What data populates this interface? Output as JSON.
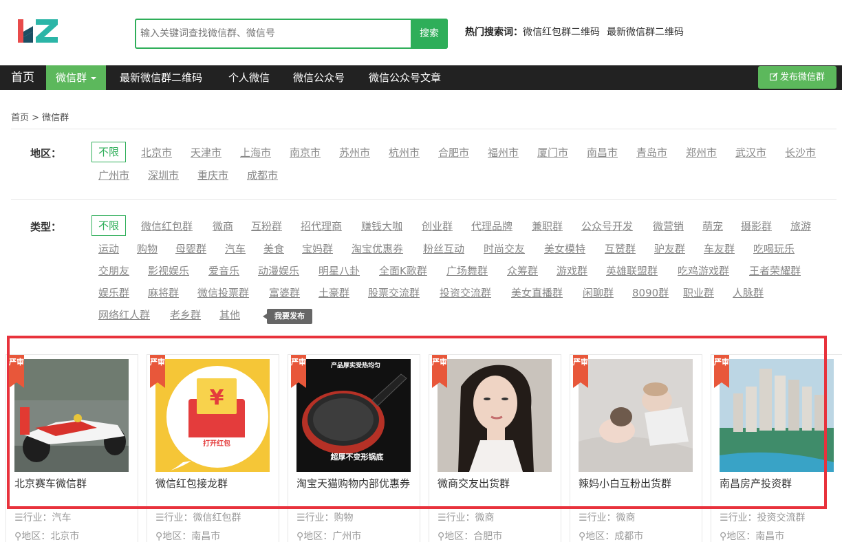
{
  "search": {
    "placeholder": "输入关键词查找微信群、微信号",
    "button": "搜索"
  },
  "hot": {
    "label": "热门搜索词：",
    "items": [
      "微信红包群二维码",
      "最新微信群二维码"
    ]
  },
  "nav": {
    "home": "首页",
    "active": "微信群",
    "items": [
      "最新微信群二维码",
      "个人微信",
      "微信公众号",
      "微信公众号文章"
    ],
    "publish": "发布微信群"
  },
  "breadcrumb": "首页 > 微信群",
  "region": {
    "label": "地区：",
    "selected": "不限",
    "items": [
      "北京市",
      "天津市",
      "上海市",
      "南京市",
      "苏州市",
      "杭州市",
      "合肥市",
      "福州市",
      "厦门市",
      "南昌市",
      "青岛市",
      "郑州市",
      "武汉市",
      "长沙市",
      "广州市",
      "深圳市",
      "重庆市",
      "成都市"
    ]
  },
  "type": {
    "label": "类型：",
    "selected": "不限",
    "items": [
      "微信红包群",
      "微商",
      "互粉群",
      "招代理商",
      "赚钱大咖",
      "创业群",
      "代理品牌",
      "兼职群",
      "公众号开发",
      "微营销",
      "萌宠",
      "摄影群",
      "旅游",
      "运动",
      "购物",
      "母婴群",
      "汽车",
      "美食",
      "宝妈群",
      "淘宝优惠券",
      "粉丝互动",
      "时尚交友",
      "美女模特",
      "互赞群",
      "驴友群",
      "车友群",
      "吃喝玩乐",
      "交朋友",
      "影视娱乐",
      "爱音乐",
      "动漫娱乐",
      "明星八卦",
      "全面K歌群",
      "广场舞群",
      "众筹群",
      "游戏群",
      "英雄联盟群",
      "吃鸡游戏群",
      "王者荣耀群",
      "娱乐群",
      "麻将群",
      "微信投票群",
      "富婆群",
      "土豪群",
      "股票交流群",
      "投资交流群",
      "美女直播群",
      "闲聊群",
      "8090群",
      "职业群",
      "人脉群",
      "网络红人群",
      "老乡群",
      "其他"
    ],
    "tooltip": "我要发布"
  },
  "badge": "严审",
  "cards": [
    {
      "name": "北京赛车微信群",
      "industry": "行业：汽车",
      "region": "地区：北京市"
    },
    {
      "name": "微信红包接龙群",
      "industry": "行业：微信红包群",
      "region": "地区：南昌市",
      "image_text": "打开红包"
    },
    {
      "name": "淘宝天猫购物内部优惠券",
      "industry": "行业：购物",
      "region": "地区：广州市",
      "image_top": "产品厚实受热均匀",
      "image_bottom": "超厚不变形锅底"
    },
    {
      "name": "微商交友出货群",
      "industry": "行业：微商",
      "region": "地区：合肥市"
    },
    {
      "name": "辣妈小白互粉出货群",
      "industry": "行业：微商",
      "region": "地区：成都市"
    },
    {
      "name": "南昌房产投资群",
      "industry": "行业：投资交流群",
      "region": "地区：南昌市"
    }
  ]
}
